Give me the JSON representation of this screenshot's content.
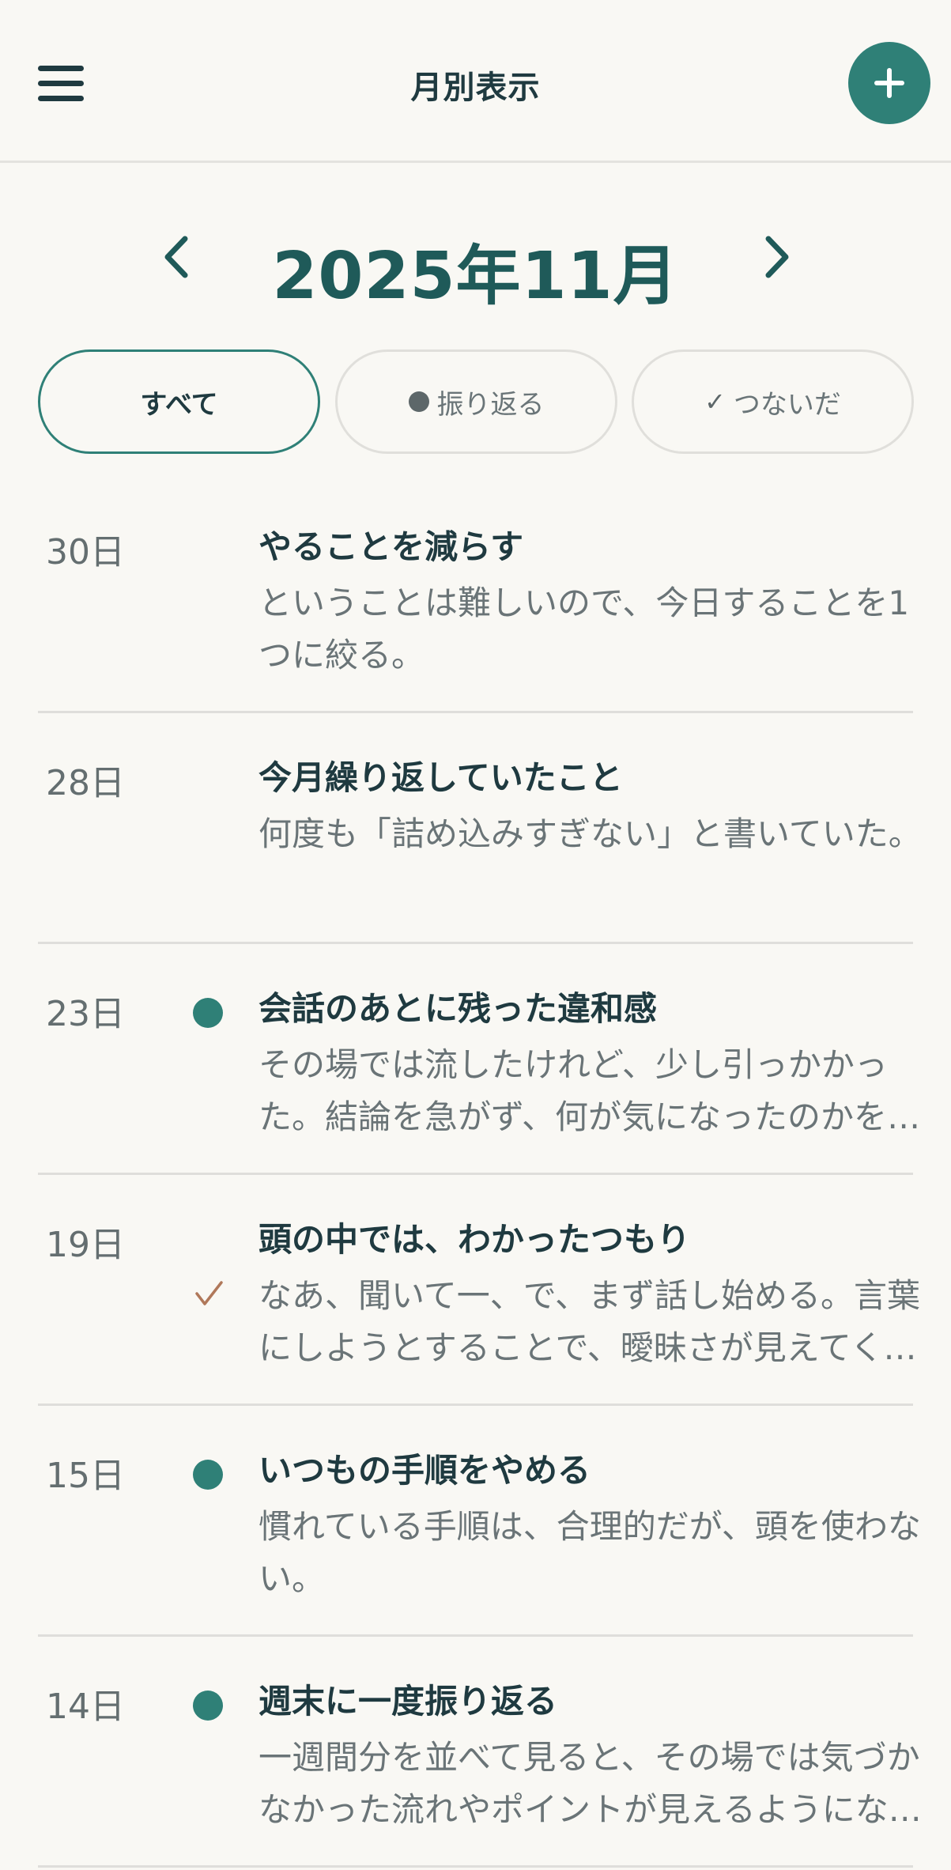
{
  "header": {
    "title": "月別表示",
    "menu_icon": "hamburger-menu-icon",
    "add_icon": "plus-icon",
    "accent_color": "#2f8077"
  },
  "month_nav": {
    "label": "2025年11月",
    "prev_icon": "chevron-left-icon",
    "next_icon": "chevron-right-icon"
  },
  "filters": [
    {
      "label": "すべて",
      "active": true
    },
    {
      "label": "振り返る",
      "icon": "dot-icon",
      "active": false
    },
    {
      "label": "つないだ",
      "icon": "check-icon",
      "check": "✓",
      "active": false
    }
  ],
  "entries": [
    {
      "date": "30日",
      "marker": "none",
      "title": "やることを減らす",
      "body": "ということは難しいので、今日することを1つに絞る。"
    },
    {
      "date": "28日",
      "marker": "none",
      "title": "今月繰り返していたこと",
      "body": "何度も「詰め込みすぎない」と書いていた。"
    },
    {
      "date": "23日",
      "marker": "dot",
      "title": "会話のあとに残った違和感",
      "body": "その場では流したけれど、少し引っかかった。結論を急がず、何が気になったのかを書いておく。"
    },
    {
      "date": "19日",
      "marker": "check",
      "title": "頭の中では、わかったつもり",
      "body": "なあ、聞いて一、で、まず話し始める。言葉にしようとすることで、曖昧さが見えてくる。"
    },
    {
      "date": "15日",
      "marker": "dot",
      "title": "いつもの手順をやめる",
      "body": "慣れている手順は、合理的だが、頭を使わない。"
    },
    {
      "date": "14日",
      "marker": "dot",
      "title": "週末に一度振り返る",
      "body": "一週間分を並べて見ると、その場では気づかなかった流れやポイントが見えるようになる。"
    }
  ],
  "colors": {
    "background": "#f9f8f4",
    "dot_marker": "#2f8077",
    "check_marker": "#b0785a"
  }
}
